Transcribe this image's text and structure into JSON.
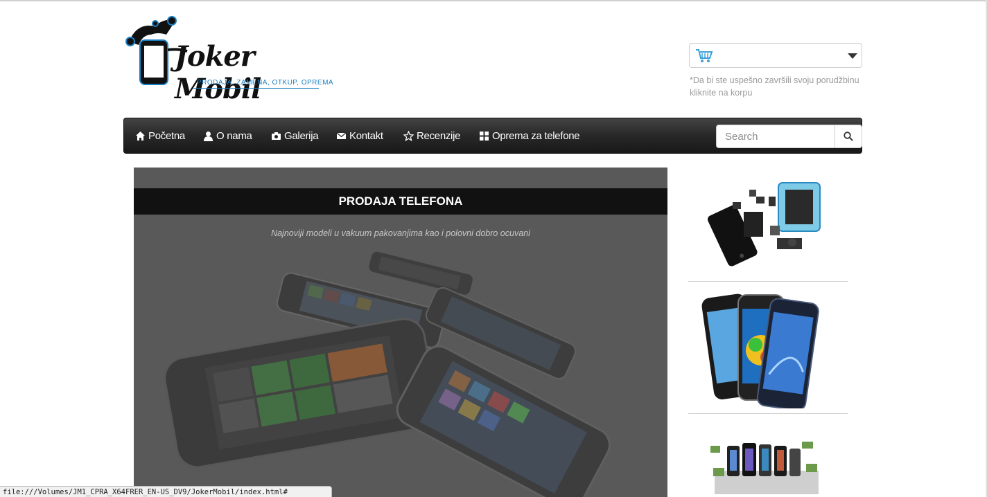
{
  "logo": {
    "word": "Joker Mobil",
    "tagline": "PRODAJA, ZAMENA, OTKUP, OPREMA"
  },
  "cart": {
    "icon": "cart-icon",
    "note": "*Da bi ste uspešno završili svoju porudžbinu kliknite na korpu"
  },
  "nav": {
    "items": [
      {
        "label": "Početna",
        "icon": "home-icon"
      },
      {
        "label": "O nama",
        "icon": "user-icon"
      },
      {
        "label": "Galerija",
        "icon": "camera-icon"
      },
      {
        "label": "Kontakt",
        "icon": "envelope-icon"
      },
      {
        "label": "Recenzije",
        "icon": "star-icon"
      },
      {
        "label": "Oprema za telefone",
        "icon": "grid-icon"
      }
    ],
    "search_placeholder": "Search",
    "search_icon": "search-icon"
  },
  "carousel": {
    "title": "PRODAJA TELEFONA",
    "caption": "Najnoviji modeli u vakuum pakovanjima kao i polovni dobro ocuvani"
  },
  "status_bar": {
    "url": "file:///Volumes/JM1_CPRA_X64FRER_EN-US_DV9/JokerMobil/index.html#"
  },
  "colors": {
    "accent_blue": "#1a7fc0",
    "navbar_dark": "#222222",
    "carousel_bg": "#595959"
  }
}
